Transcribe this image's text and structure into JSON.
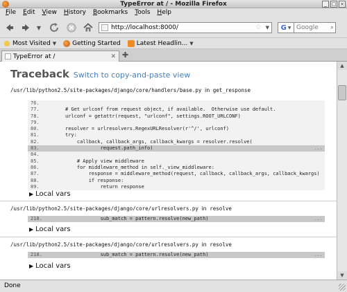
{
  "window": {
    "title": "TypeError at / - Mozilla Firefox"
  },
  "menu": [
    "File",
    "Edit",
    "View",
    "History",
    "Bookmarks",
    "Tools",
    "Help"
  ],
  "nav": {
    "url": "http://localhost:8000/",
    "search_placeholder": "Google"
  },
  "bookmarks": [
    {
      "label": "Most Visited",
      "icon": "star-icon",
      "dropdown": true
    },
    {
      "label": "Getting Started",
      "icon": "firefox-icon",
      "dropdown": false
    },
    {
      "label": "Latest Headlin...",
      "icon": "rss-icon",
      "dropdown": true
    }
  ],
  "tab": {
    "label": "TypeError at /"
  },
  "page": {
    "heading": "Traceback",
    "switch_link": "Switch to copy-and-paste view",
    "local_vars_label": "Local vars",
    "frames": [
      {
        "file": "/usr/lib/python2.5/site-packages/django/core/handlers/base.py",
        "in_word": "in",
        "func": "get_response",
        "lines": [
          {
            "n": "76.",
            "code": ""
          },
          {
            "n": "77.",
            "code": "# Get urlconf from request object, if available.  Otherwise use default."
          },
          {
            "n": "78.",
            "code": "urlconf = getattr(request, \"urlconf\", settings.ROOT_URLCONF)"
          },
          {
            "n": "79.",
            "code": ""
          },
          {
            "n": "80.",
            "code": "resolver = urlresolvers.RegexURLResolver(r'^/', urlconf)"
          },
          {
            "n": "81.",
            "code": "try:"
          },
          {
            "n": "82.",
            "code": "    callback, callback_args, callback_kwargs = resolver.resolve("
          },
          {
            "n": "83.",
            "code": "            request.path_info)",
            "hl": true
          },
          {
            "n": "84.",
            "code": ""
          },
          {
            "n": "85.",
            "code": "    # Apply view middleware"
          },
          {
            "n": "86.",
            "code": "    for middleware_method in self._view_middleware:"
          },
          {
            "n": "87.",
            "code": "        response = middleware_method(request, callback, callback_args, callback_kwargs)"
          },
          {
            "n": "88.",
            "code": "        if response:"
          },
          {
            "n": "89.",
            "code": "            return response"
          }
        ]
      },
      {
        "file": "/usr/lib/python2.5/site-packages/django/core/urlresolvers.py",
        "in_word": "in",
        "func": "resolve",
        "lines": [
          {
            "n": "218.",
            "code": "            sub_match = pattern.resolve(new_path)",
            "hl": true
          }
        ]
      },
      {
        "file": "/usr/lib/python2.5/site-packages/django/core/urlresolvers.py",
        "in_word": "in",
        "func": "resolve",
        "lines": [
          {
            "n": "218.",
            "code": "            sub_match = pattern.resolve(new_path)",
            "hl": true
          }
        ]
      }
    ]
  },
  "status": {
    "text": "Done"
  }
}
